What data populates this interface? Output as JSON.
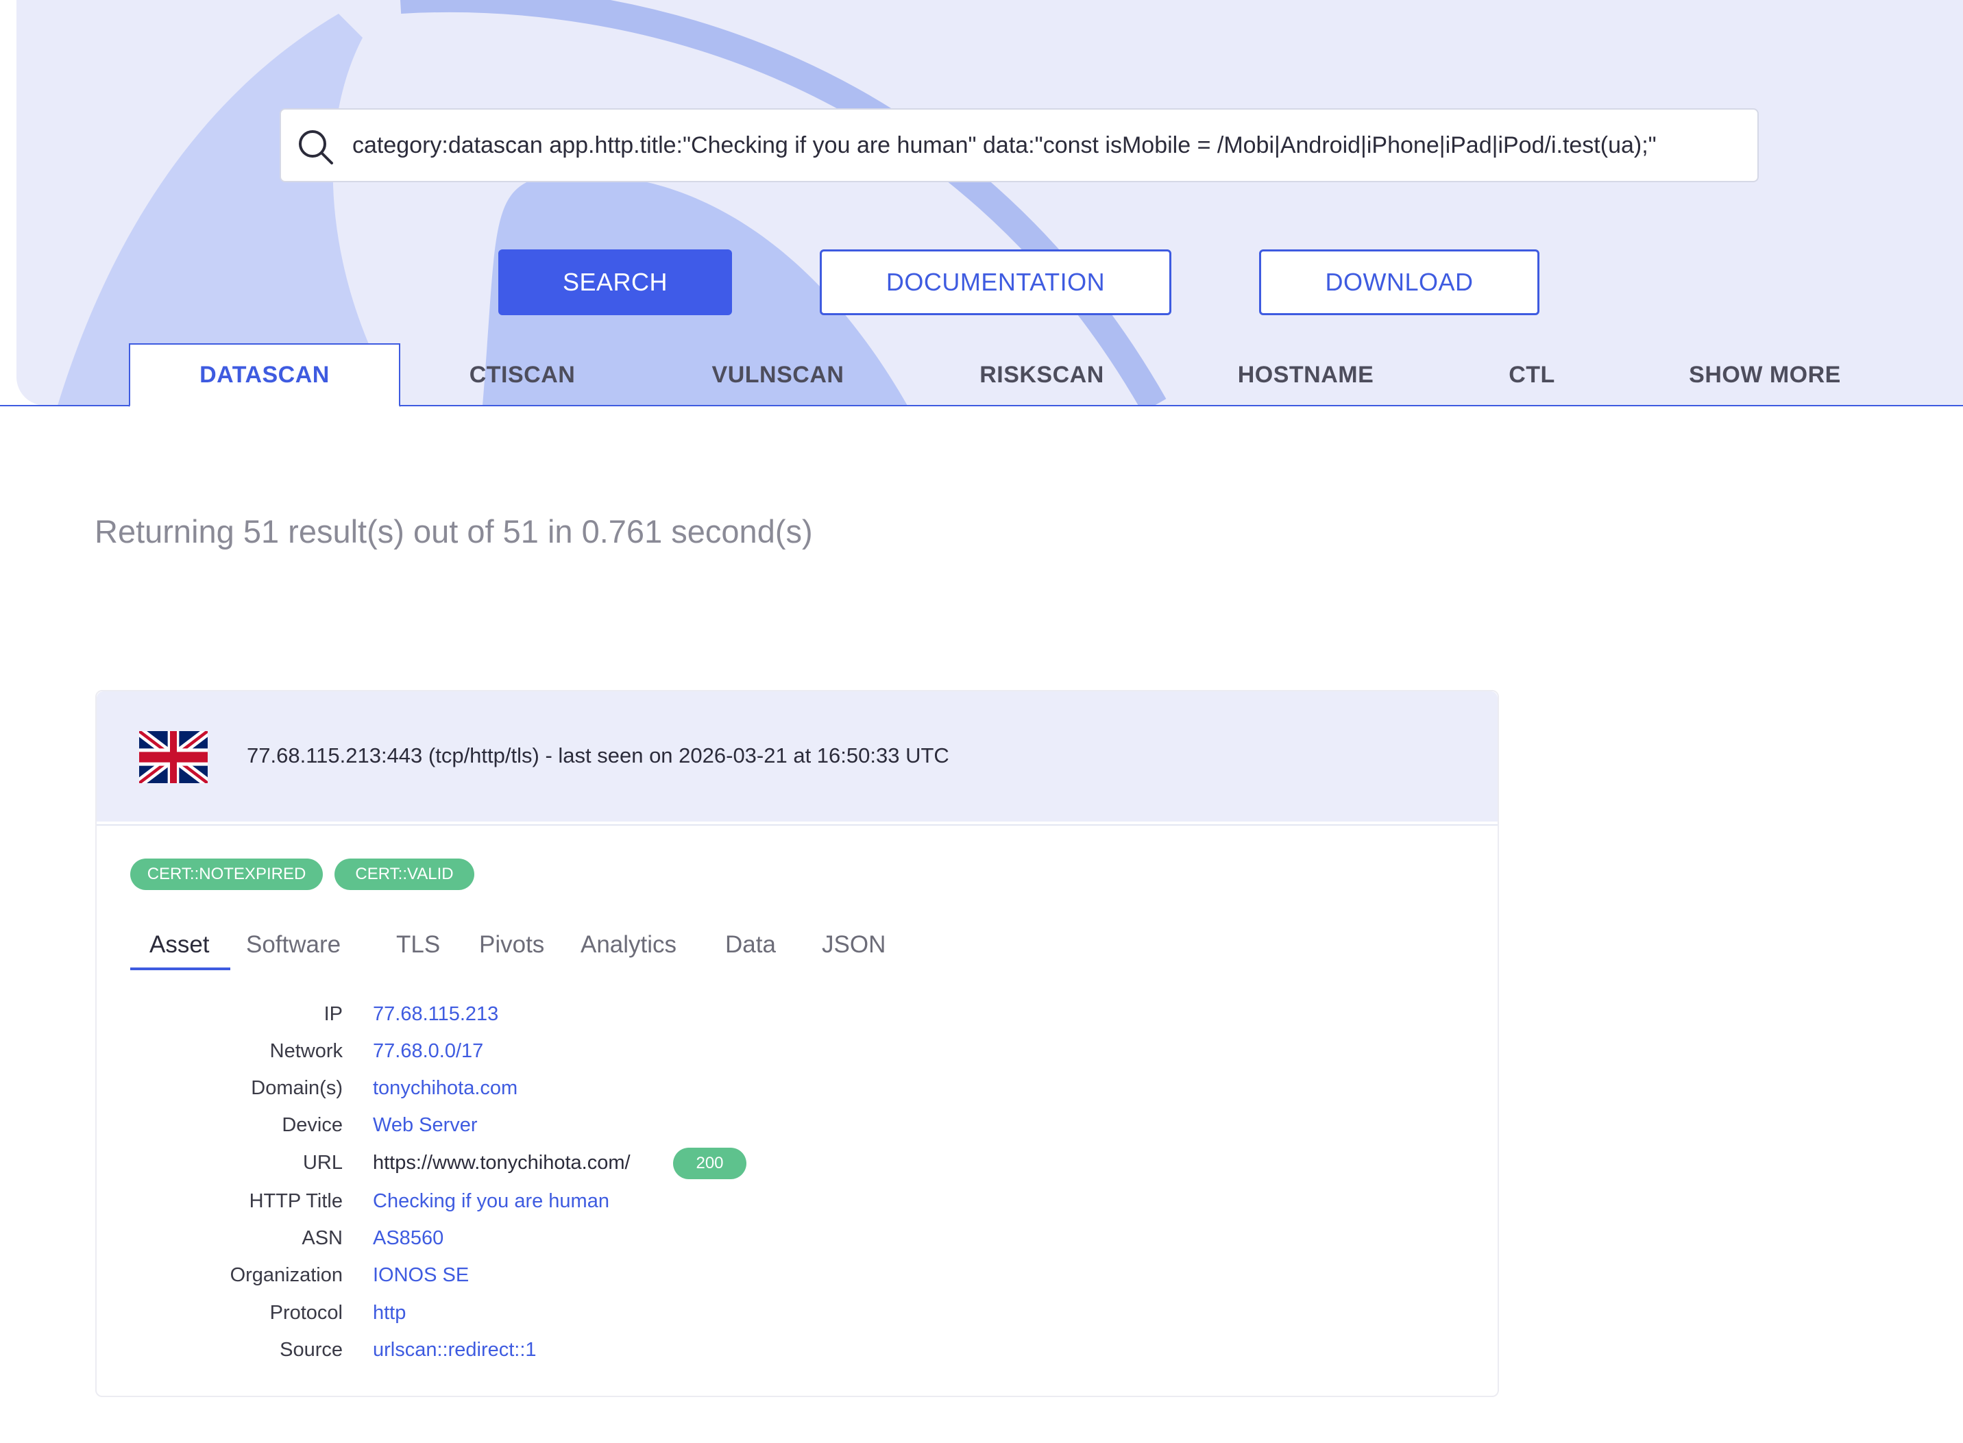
{
  "search": {
    "query": "category:datascan app.http.title:\"Checking if you are human\" data:\"const isMobile = /Mobi|Android|iPhone|iPad|iPod/i.test(ua);\""
  },
  "actions": {
    "search_label": "SEARCH",
    "documentation_label": "DOCUMENTATION",
    "download_label": "DOWNLOAD"
  },
  "tabs": [
    {
      "label": "DATASCAN",
      "active": true
    },
    {
      "label": "CTISCAN"
    },
    {
      "label": "VULNSCAN"
    },
    {
      "label": "RISKSCAN"
    },
    {
      "label": "HOSTNAME"
    },
    {
      "label": "CTL"
    },
    {
      "label": "SHOW MORE"
    }
  ],
  "results": {
    "summary": "Returning 51 result(s) out of 51 in 0.761 second(s)"
  },
  "card": {
    "flag_icon": "uk-flag-icon",
    "title": "77.68.115.213:443 (tcp/http/tls) - last seen on 2026-03-21 at 16:50:33 UTC",
    "tags": [
      "CERT::NOTEXPIRED",
      "CERT::VALID"
    ],
    "subtabs": [
      "Asset",
      "Software",
      "TLS",
      "Pivots",
      "Analytics",
      "Data",
      "JSON"
    ],
    "active_subtab": "Asset",
    "fields": [
      {
        "label": "IP",
        "value": "77.68.115.213"
      },
      {
        "label": "Network",
        "value": "77.68.0.0/17"
      },
      {
        "label": "Domain(s)",
        "value": "tonychihota.com"
      },
      {
        "label": "Device",
        "value": "Web Server"
      },
      {
        "label": "URL",
        "value": "https://www.tonychihota.com/",
        "badge": "200"
      },
      {
        "label": "HTTP Title",
        "value": "Checking if you are human"
      },
      {
        "label": "ASN",
        "value": "AS8560"
      },
      {
        "label": "Organization",
        "value": "IONOS SE"
      },
      {
        "label": "Protocol",
        "value": "http"
      },
      {
        "label": "Source",
        "value": "urlscan::redirect::1"
      }
    ]
  },
  "colors": {
    "accent": "#3e5be0",
    "hero_bg": "#e9ebfa",
    "tag_green": "#5ec28d"
  }
}
